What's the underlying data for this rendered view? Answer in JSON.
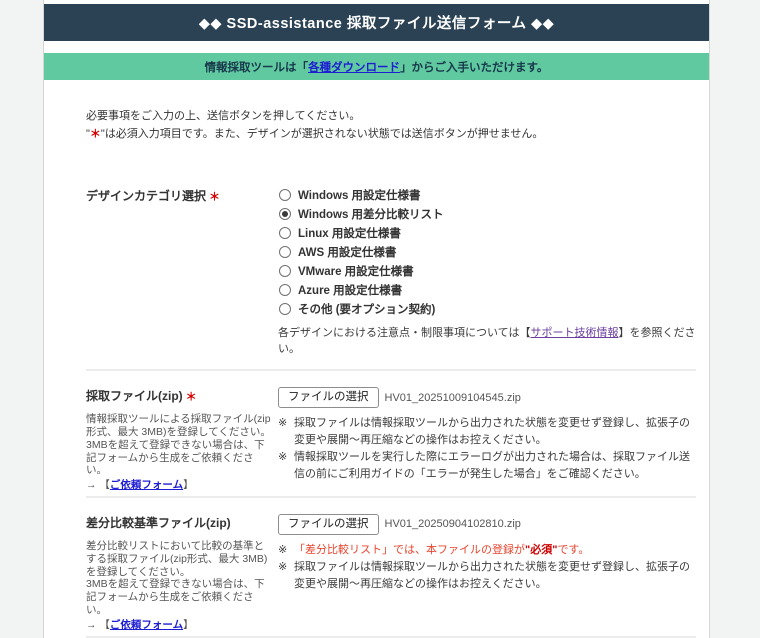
{
  "page": {
    "title": "◆◆ SSD-assistance 採取ファイル送信フォーム ◆◆"
  },
  "banner": {
    "prefix": "情報採取ツールは「",
    "link_label": "各種ダウンロード",
    "suffix": "」からご入手いただけます。"
  },
  "intro": {
    "line1": "必要事項をご入力の上、送信ボタンを押してください。",
    "quote": "\"",
    "asterisk": "＊",
    "line2": "は必須入力項目です。また、デザインが選択されない状態では送信ボタンが押せません。"
  },
  "marks": {
    "arrow": "→ ",
    "bracket_open": "【",
    "bracket_close": "】",
    "note": "※"
  },
  "design_category": {
    "label": "デザインカテゴリ選択",
    "required_mark": "＊",
    "options": [
      {
        "label": "Windows 用設定仕様書",
        "checked": false
      },
      {
        "label": "Windows 用差分比較リスト",
        "checked": true
      },
      {
        "label": "Linux 用設定仕様書",
        "checked": false
      },
      {
        "label": "AWS 用設定仕様書",
        "checked": false
      },
      {
        "label": "VMware 用設定仕様書",
        "checked": false
      },
      {
        "label": "Azure 用設定仕様書",
        "checked": false
      },
      {
        "label": "その他 (要オプション契約)",
        "checked": false
      }
    ],
    "note_pre": "各デザインにおける注意点・制限事項については【",
    "note_link": "サポート技術情報",
    "note_post": "】を参照ください。"
  },
  "file_section1": {
    "label": "採取ファイル(zip)",
    "required_mark": "＊",
    "desc1": "情報採取ツールによる採取ファイル(zip形式、最大 3MB)を登録してください。",
    "desc2": "3MBを超えて登録できない場合は、下記フォームから生成をご依頼ください。",
    "request_form_link": "ご依頼フォーム",
    "button_label": "ファイルの選択",
    "filename": "HV01_20251009104545.zip",
    "notes": [
      "採取ファイルは情報採取ツールから出力された状態を変更せず登録し、拡張子の変更や展開～再圧縮などの操作はお控えください。",
      "情報採取ツールを実行した際にエラーログが出力された場合は、採取ファイル送信の前にご利用ガイドの「エラーが発生した場合」をご確認ください。"
    ]
  },
  "file_section2": {
    "label": "差分比較基準ファイル(zip)",
    "desc1": "差分比較リストにおいて比較の基準とする採取ファイル(zip形式、最大 3MB)を登録してください。",
    "desc2": "3MBを超えて登録できない場合は、下記フォームから生成をご依頼ください。",
    "request_form_link": "ご依頼フォーム",
    "button_label": "ファイルの選択",
    "filename": "HV01_20250904102810.zip",
    "red_note_head": "「差分比較リスト」では、本ファイルの登録が",
    "red_note_emph": "\"必須\"",
    "red_note_tail": "です。",
    "note": "採取ファイルは情報採取ツールから出力された状態を変更せず登録し、拡張子の変更や展開～再圧縮などの操作はお控えください。"
  },
  "colors": {
    "page_bg": "#f2f4f3",
    "header_bg": "#2b4254",
    "banner_bg": "#60c9a0",
    "banner_text": "#17384b",
    "link_blue": "#1e1ed2",
    "link_visited": "#6b3fa0",
    "required_red": "#d40000",
    "warning_red": "#e8452e",
    "emphasis_red": "#cc0000"
  }
}
